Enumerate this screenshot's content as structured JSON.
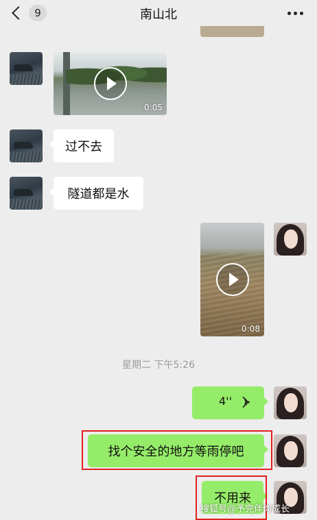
{
  "header": {
    "back_label": "<",
    "unread_count": "9",
    "title": "南山北",
    "more_icon": "more-icon"
  },
  "messages": [
    {
      "type": "video",
      "side": "left",
      "duration": "0:05"
    },
    {
      "type": "text",
      "side": "left",
      "text": "过不去"
    },
    {
      "type": "text",
      "side": "left",
      "text": "隧道都是水"
    },
    {
      "type": "video",
      "side": "right",
      "duration": "0:08"
    },
    {
      "type": "timestamp",
      "text": "星期二 下午5:26"
    },
    {
      "type": "voice",
      "side": "right",
      "duration": "4''"
    },
    {
      "type": "text",
      "side": "right",
      "text": "找个安全的地方等雨停吧"
    },
    {
      "type": "text",
      "side": "right",
      "text": "不用来"
    }
  ],
  "watermark": "搜狐号@予完伴你成长",
  "colors": {
    "background": "#ededed",
    "bubble_self": "#95ec69",
    "bubble_other": "#ffffff",
    "highlight_box": "#e0201d"
  }
}
